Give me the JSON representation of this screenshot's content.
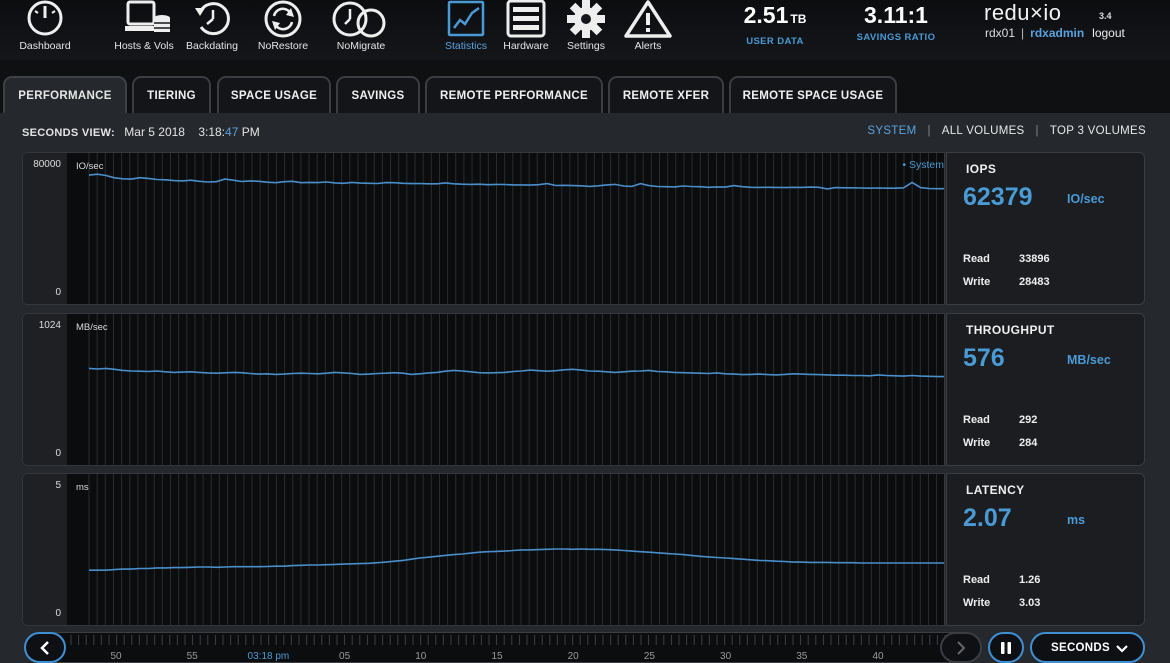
{
  "nav": {
    "items": [
      {
        "label": "Dashboard",
        "icon": "dashboard-gauge-icon"
      },
      {
        "label": "Hosts & Vols",
        "icon": "hosts-volumes-icon"
      },
      {
        "label": "Backdating",
        "icon": "backdating-clock-icon"
      },
      {
        "label": "NoRestore",
        "icon": "norestore-refresh-icon"
      },
      {
        "label": "NoMigrate",
        "icon": "nomigrate-clock-icon"
      },
      {
        "label": "Statistics",
        "icon": "statistics-chart-icon",
        "active": true
      },
      {
        "label": "Hardware",
        "icon": "hardware-server-icon"
      },
      {
        "label": "Settings",
        "icon": "settings-gear-icon"
      },
      {
        "label": "Alerts",
        "icon": "alerts-warning-icon"
      }
    ]
  },
  "stats": {
    "user_data": {
      "value": "2.51",
      "unit": "TB",
      "label": "USER DATA"
    },
    "savings_ratio": {
      "value": "3.11:1",
      "label": "SAVINGS RATIO"
    }
  },
  "brand": {
    "name": "redu×io",
    "version": "3.4"
  },
  "user": {
    "host": "rdx01",
    "separator": "|",
    "username": "rdxadmin",
    "logout": "logout"
  },
  "tabs": [
    "PERFORMANCE",
    "TIERING",
    "SPACE USAGE",
    "SAVINGS",
    "REMOTE PERFORMANCE",
    "REMOTE XFER",
    "REMOTE SPACE USAGE"
  ],
  "active_tab": "PERFORMANCE",
  "view": {
    "label": "SECONDS VIEW:",
    "date": "Mar 5 2018",
    "time_hm": "3:18:",
    "time_sec": "47",
    "ampm": "PM",
    "options": [
      "SYSTEM",
      "ALL VOLUMES",
      "TOP 3 VOLUMES"
    ],
    "selected": "SYSTEM",
    "separator": "|"
  },
  "colors": {
    "accent": "#4a9ad6",
    "line": "#4a8fcc",
    "background": "#25282d"
  },
  "metrics": {
    "iops": {
      "title": "IOPS",
      "value": "62379",
      "unit": "IO/sec",
      "read_label": "Read",
      "read": "33896",
      "write_label": "Write",
      "write": "28483"
    },
    "throughput": {
      "title": "THROUGHPUT",
      "value": "576",
      "unit": "MB/sec",
      "read_label": "Read",
      "read": "292",
      "write_label": "Write",
      "write": "284"
    },
    "latency": {
      "title": "LATENCY",
      "value": "2.07",
      "unit": "ms",
      "read_label": "Read",
      "read": "1.26",
      "write_label": "Write",
      "write": "3.03"
    }
  },
  "chart_data": [
    {
      "type": "line",
      "ylabel": "IO/sec",
      "ylim": [
        0,
        80000
      ],
      "tick_labels": [
        "80000",
        "0"
      ],
      "series": [
        {
          "name": "• System",
          "values": [
            70000,
            70500,
            69800,
            68500,
            68000,
            67800,
            68600,
            68200,
            67600,
            67400,
            67000,
            66800,
            67200,
            66600,
            66200,
            66400,
            67800,
            67200,
            66500,
            66800,
            66600,
            66100,
            65800,
            66400,
            66600,
            65800,
            66000,
            65900,
            66200,
            65700,
            65500,
            66000,
            65600,
            65500,
            65400,
            65900,
            65800,
            65500,
            65300,
            65400,
            65200,
            65200,
            65700,
            65200,
            65000,
            64900,
            65000,
            64700,
            64900,
            64800,
            64600,
            64600,
            64500,
            64700,
            65300,
            64300,
            64400,
            64200,
            64100,
            63800,
            64100,
            64600,
            64900,
            64000,
            63800,
            65300,
            64200,
            63700,
            63600,
            63500,
            64000,
            63700,
            63600,
            63300,
            63500,
            63400,
            64200,
            63600,
            63300,
            63200,
            63300,
            63200,
            63100,
            63300,
            63200,
            63400,
            63300,
            62400,
            63100,
            63000,
            63000,
            62900,
            62800,
            62900,
            62800,
            62800,
            63000,
            66000,
            63100,
            62600,
            62500,
            62500
          ]
        }
      ],
      "legend": "top-right",
      "grid": true
    },
    {
      "type": "line",
      "ylabel": "MB/sec",
      "ylim": [
        0,
        1024
      ],
      "tick_labels": [
        "1024",
        "0"
      ],
      "series": [
        {
          "name": "System",
          "values": [
            668,
            664,
            668,
            662,
            654,
            650,
            648,
            646,
            650,
            644,
            640,
            642,
            644,
            640,
            636,
            634,
            637,
            640,
            638,
            632,
            628,
            630,
            626,
            628,
            632,
            634,
            632,
            630,
            634,
            640,
            636,
            632,
            626,
            628,
            632,
            634,
            638,
            634,
            626,
            630,
            636,
            640,
            648,
            654,
            650,
            644,
            638,
            636,
            638,
            640,
            646,
            650,
            656,
            652,
            648,
            652,
            658,
            662,
            656,
            650,
            648,
            644,
            640,
            644,
            648,
            650,
            654,
            646,
            644,
            640,
            638,
            636,
            634,
            632,
            636,
            630,
            628,
            624,
            626,
            628,
            624,
            622,
            626,
            630,
            628,
            626,
            624,
            622,
            620,
            620,
            618,
            618,
            616,
            622,
            618,
            616,
            614,
            618,
            614,
            612,
            610,
            610
          ]
        }
      ],
      "grid": true
    },
    {
      "type": "line",
      "ylabel": "ms",
      "ylim": [
        0,
        5
      ],
      "tick_labels": [
        "5",
        "0"
      ],
      "series": [
        {
          "name": "System",
          "values": [
            1.82,
            1.82,
            1.82,
            1.84,
            1.86,
            1.86,
            1.88,
            1.88,
            1.9,
            1.9,
            1.91,
            1.91,
            1.92,
            1.93,
            1.93,
            1.92,
            1.93,
            1.94,
            1.94,
            1.94,
            1.94,
            1.95,
            1.96,
            1.96,
            1.98,
            1.99,
            2.0,
            2.0,
            2.01,
            2.02,
            2.03,
            2.04,
            2.05,
            2.06,
            2.08,
            2.1,
            2.13,
            2.16,
            2.2,
            2.24,
            2.27,
            2.3,
            2.33,
            2.36,
            2.38,
            2.41,
            2.44,
            2.46,
            2.47,
            2.48,
            2.5,
            2.52,
            2.52,
            2.53,
            2.54,
            2.55,
            2.55,
            2.54,
            2.55,
            2.54,
            2.54,
            2.53,
            2.52,
            2.5,
            2.48,
            2.46,
            2.44,
            2.42,
            2.4,
            2.38,
            2.36,
            2.33,
            2.3,
            2.28,
            2.26,
            2.24,
            2.22,
            2.2,
            2.18,
            2.16,
            2.15,
            2.13,
            2.12,
            2.1,
            2.1,
            2.09,
            2.09,
            2.09,
            2.08,
            2.08,
            2.08,
            2.07,
            2.07,
            2.07,
            2.07,
            2.07,
            2.07,
            2.07,
            2.07,
            2.07,
            2.07,
            2.07
          ]
        }
      ],
      "grid": true
    }
  ],
  "timeline": {
    "labels": [
      "50",
      "55",
      "03:18 pm",
      "05",
      "10",
      "15",
      "20",
      "25",
      "30",
      "35",
      "40"
    ],
    "current_label": "03:18 pm",
    "range_button": "SECONDS"
  }
}
